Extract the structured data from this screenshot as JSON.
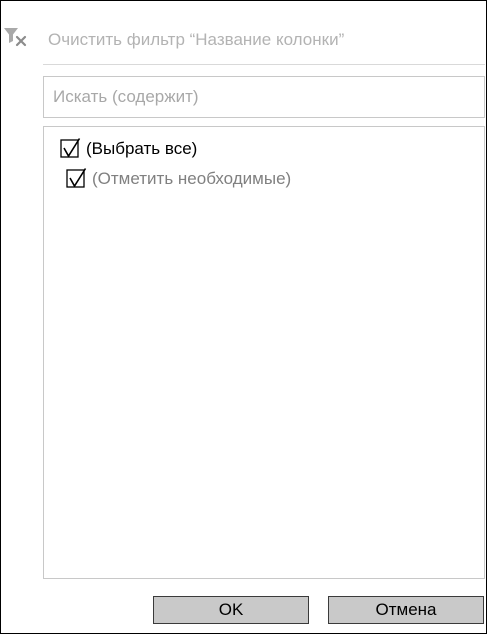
{
  "filter_menu": {
    "clear_filter": {
      "label": "Очистить фильтр “Название колонки”",
      "icon": "filter-clear-icon"
    },
    "search": {
      "placeholder": "Искать (содержит)",
      "value": ""
    },
    "items": [
      {
        "label": "(Выбрать все)",
        "checked": true,
        "icon": "checkbox-checked-icon"
      },
      {
        "label": "(Отметить необходимые)",
        "checked": true,
        "icon": "checkbox-checked-icon"
      }
    ],
    "buttons": {
      "ok_label": "OK",
      "cancel_label": "Отмена"
    },
    "colors": {
      "muted_text": "#b3b3b3",
      "border": "#c8c8c8",
      "button_bg": "#c9c9c9"
    }
  }
}
